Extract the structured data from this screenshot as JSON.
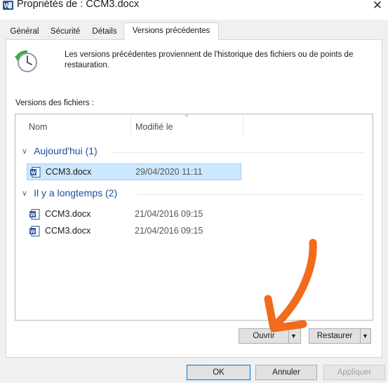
{
  "window": {
    "title": "Propriétés de : CCM3.docx",
    "close_symbol": "✕"
  },
  "tabs": [
    {
      "label": "Général"
    },
    {
      "label": "Sécurité"
    },
    {
      "label": "Détails"
    },
    {
      "label": "Versions précédentes",
      "active": true
    }
  ],
  "panel": {
    "info_line1": "Les versions précédentes proviennent de l'historique des fichiers ou de points de",
    "info_line2": "restauration.",
    "versions_label": "Versions des fichiers :",
    "columns": {
      "name": "Nom",
      "modified": "Modifié le"
    },
    "groups": [
      {
        "label": "Aujourd'hui (1)",
        "items": [
          {
            "name": "CCM3.docx",
            "date": "29/04/2020 11:11",
            "selected": true
          }
        ]
      },
      {
        "label": "Il y a longtemps (2)",
        "items": [
          {
            "name": "CCM3.docx",
            "date": "21/04/2016 09:15",
            "selected": false
          },
          {
            "name": "CCM3.docx",
            "date": "21/04/2016 09:15",
            "selected": false
          }
        ]
      }
    ],
    "buttons": {
      "open": "Ouvrir",
      "restore": "Restaurer"
    }
  },
  "footer": {
    "ok": "OK",
    "cancel": "Annuler",
    "apply": "Appliquer"
  },
  "icons": {
    "app": "word-document-icon",
    "restore": "restore-clock-icon",
    "file": "word-document-icon",
    "annotation": "orange-arrow-annotation"
  },
  "colors": {
    "accent": "#0078d7",
    "selection": "#cce8ff",
    "group_text": "#1e4d9c",
    "annotation": "#f26a1b"
  }
}
